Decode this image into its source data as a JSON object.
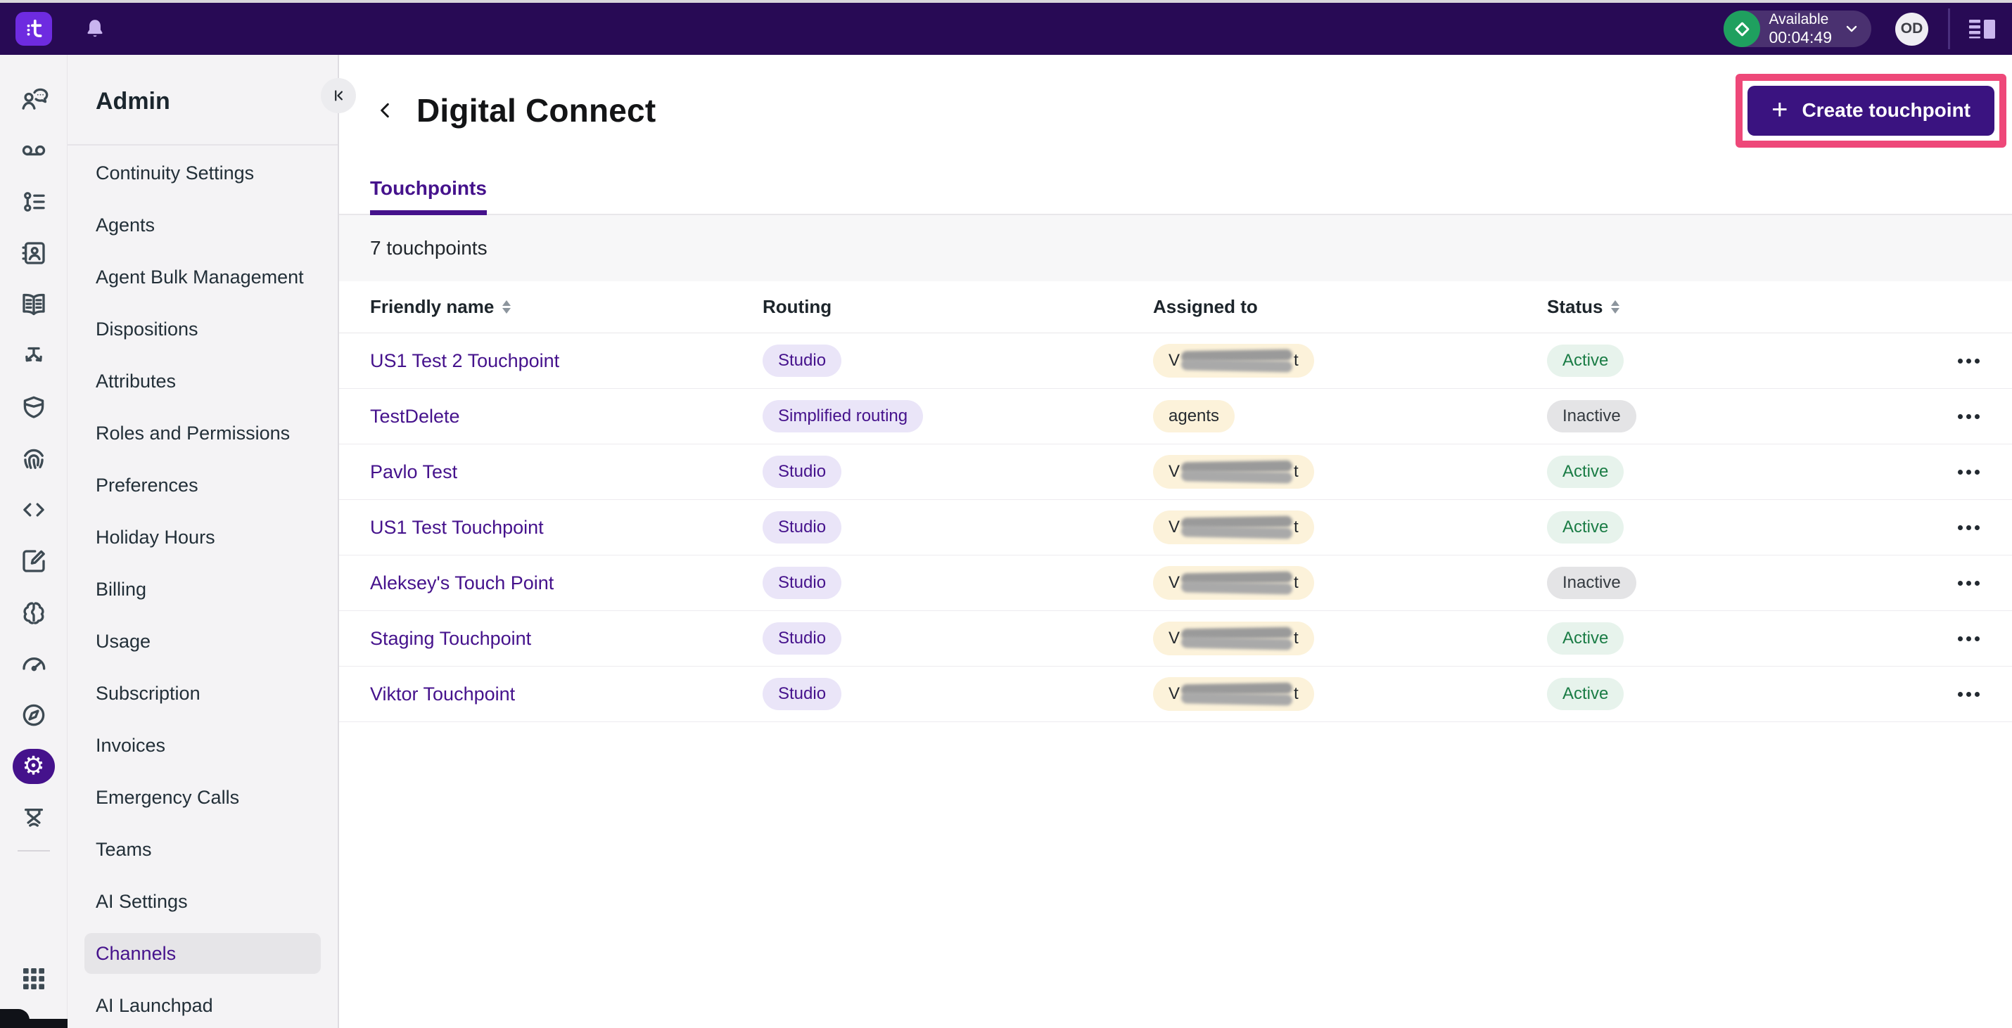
{
  "topbar": {
    "logo_letter": "t",
    "status": {
      "label": "Available",
      "timer": "00:04:49"
    },
    "avatar_initials": "OD"
  },
  "rail_icons": [
    "conversations",
    "voicemail",
    "activities",
    "contacts",
    "knowledge",
    "studio",
    "guardian",
    "identity",
    "developer",
    "feedback",
    "ai-brain",
    "dashboard",
    "explore",
    "settings",
    "academy",
    "apps-grid"
  ],
  "sidebar": {
    "title": "Admin",
    "selected": "Channels",
    "items": [
      "Continuity Settings",
      "Agents",
      "Agent Bulk Management",
      "Dispositions",
      "Attributes",
      "Roles and Permissions",
      "Preferences",
      "Holiday Hours",
      "Billing",
      "Usage",
      "Subscription",
      "Invoices",
      "Emergency Calls",
      "Teams",
      "AI Settings",
      "Channels",
      "AI Launchpad"
    ]
  },
  "main": {
    "title": "Digital Connect",
    "create_button_label": "Create touchpoint",
    "tab": "Touchpoints",
    "count_text": "7 touchpoints",
    "columns": [
      "Friendly name",
      "Routing",
      "Assigned to",
      "Status"
    ],
    "sortable_columns": [
      "Friendly name",
      "Status"
    ],
    "rows": [
      {
        "name": "US1 Test 2 Touchpoint",
        "routing": "Studio",
        "assigned": {
          "masked": true,
          "visible_start": "V",
          "visible_end": "t"
        },
        "status": "Active"
      },
      {
        "name": "TestDelete",
        "routing": "Simplified routing",
        "assigned": {
          "masked": false,
          "text": "agents"
        },
        "status": "Inactive"
      },
      {
        "name": "Pavlo Test",
        "routing": "Studio",
        "assigned": {
          "masked": true,
          "visible_start": "V",
          "visible_end": "t"
        },
        "status": "Active"
      },
      {
        "name": "US1 Test Touchpoint",
        "routing": "Studio",
        "assigned": {
          "masked": true,
          "visible_start": "V",
          "visible_end": "t"
        },
        "status": "Active"
      },
      {
        "name": "Aleksey's Touch Point",
        "routing": "Studio",
        "assigned": {
          "masked": true,
          "visible_start": "V",
          "visible_end": "t"
        },
        "status": "Inactive"
      },
      {
        "name": "Staging Touchpoint",
        "routing": "Studio",
        "assigned": {
          "masked": true,
          "visible_start": "V",
          "visible_end": "t"
        },
        "status": "Active"
      },
      {
        "name": "Viktor Touchpoint",
        "routing": "Studio",
        "assigned": {
          "masked": true,
          "visible_start": "V",
          "visible_end": "t"
        },
        "status": "Active"
      }
    ]
  },
  "colors": {
    "topbar": "#280A55",
    "logo": "#6E2BE0",
    "accent_purple": "#45128C",
    "create_button": "#3A1380",
    "annotation_pink": "#EE4879",
    "available_green": "#1FA05F",
    "active_text": "#1A7C45",
    "active_bg": "#E7F3EC",
    "inactive_bg": "#E4E4E6",
    "routing_badge_bg": "#EAE5F8",
    "assigned_badge_bg": "#FCF2DA"
  }
}
